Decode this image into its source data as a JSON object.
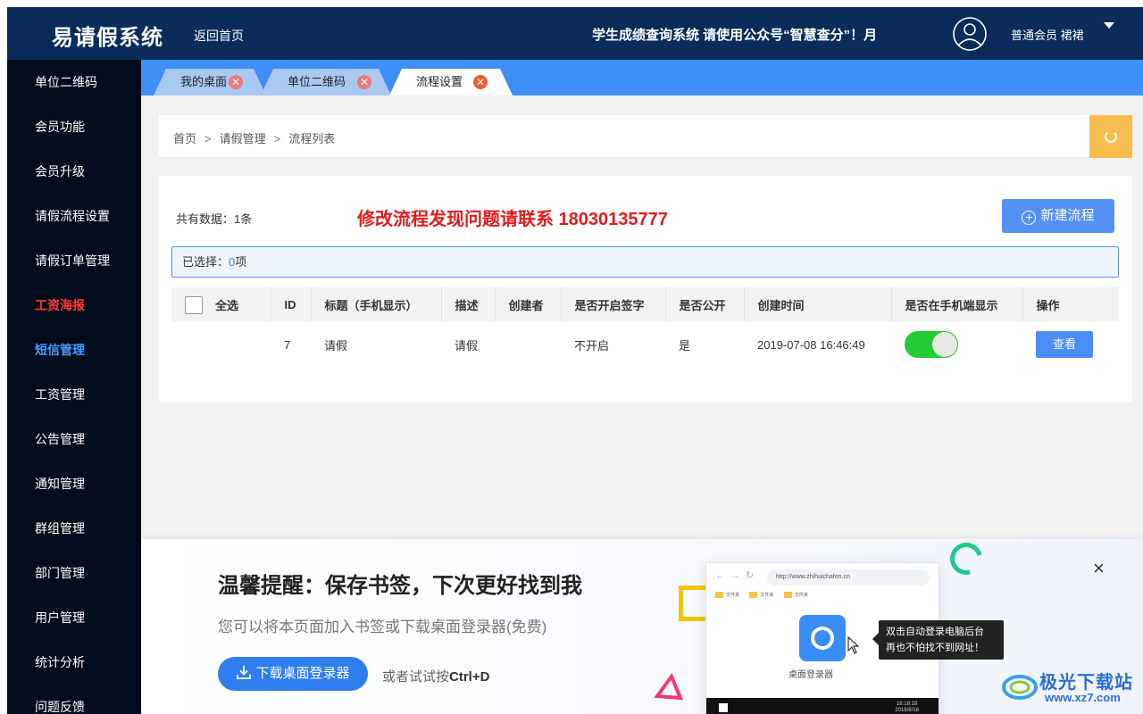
{
  "header": {
    "logo": "易请假系统",
    "home_link": "返回首页",
    "marquee": "学生成绩查询系统 请使用公众号“智慧查分”！月",
    "member": "普通会员 裙裙"
  },
  "sidebar": {
    "items": [
      {
        "label": "单位二维码"
      },
      {
        "label": "会员功能"
      },
      {
        "label": "会员升级"
      },
      {
        "label": "请假流程设置"
      },
      {
        "label": "请假订单管理"
      },
      {
        "label": "工资海报"
      },
      {
        "label": "短信管理"
      },
      {
        "label": "工资管理"
      },
      {
        "label": "公告管理"
      },
      {
        "label": "通知管理"
      },
      {
        "label": "群组管理"
      },
      {
        "label": "部门管理"
      },
      {
        "label": "用户管理"
      },
      {
        "label": "统计分析"
      },
      {
        "label": "问题反馈"
      }
    ]
  },
  "tabs": [
    {
      "label": "我的桌面"
    },
    {
      "label": "单位二维码"
    },
    {
      "label": "流程设置"
    }
  ],
  "breadcrumb": [
    "首页",
    "请假管理",
    "流程列表"
  ],
  "breadcrumb_sep": ">",
  "panel": {
    "total": "共有数据：1条",
    "notice": "修改流程发现问题请联系 18030135777",
    "new_button": "新建流程",
    "selected_prefix": "已选择：",
    "selected_count": "0",
    "selected_suffix": "项"
  },
  "table": {
    "headers": [
      "全选",
      "ID",
      "标题（手机显示）",
      "描述",
      "创建者",
      "是否开启签字",
      "是否公开",
      "创建时间",
      "是否在手机端显示",
      "操作"
    ],
    "rows": [
      {
        "id": "7",
        "title": "请假",
        "desc": "请假",
        "creator": "",
        "sign": "不开启",
        "public": "是",
        "created": "2019-07-08 16:46:49",
        "mobile_show": true,
        "action": "查看"
      }
    ]
  },
  "promo": {
    "title": "温馨提醒：保存书签，下次更好找到我",
    "subtitle": "您可以将本页面加入书签或下载桌面登录器(免费)",
    "download_button": "下载桌面登录器",
    "alt_prefix": "或者试试按",
    "alt_keys": "Ctrl+D",
    "close": "×",
    "mock_url": "http://www.zhihuichafen.cn",
    "mock_folders": [
      "文件夹",
      "文件夹",
      "文件夹"
    ],
    "mock_app_label": "桌面登录器",
    "mock_time": "18:18:18",
    "mock_date": "2018/8/18",
    "tip_line1": "双击自动登录电脑后台",
    "tip_line2": "再也不怕找不到网址！"
  },
  "watermark": {
    "text": "极光下载站",
    "url": "www.xz7.com"
  },
  "colors": {
    "header_bg": "#092c5a",
    "sidebar_bg": "#010c1c",
    "tabbar_bg": "#3d8ff7",
    "accent_red": "#e11c1c",
    "button_blue": "#5590f5",
    "switch_on": "#22cc33",
    "refresh_bg": "#f7bd4f"
  }
}
